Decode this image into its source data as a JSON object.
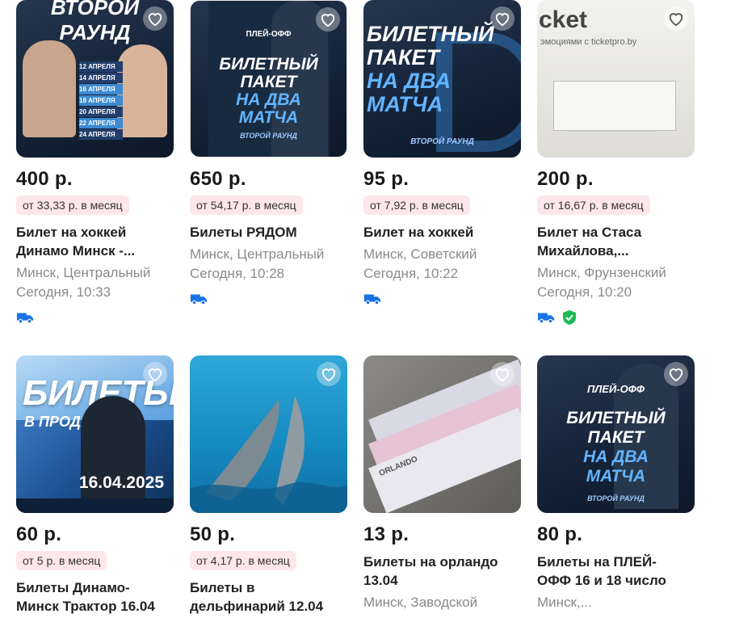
{
  "colors": {
    "credit_bg": "#fde7ea",
    "delivery": "#1a73e8",
    "verified": "#1db954"
  },
  "cards": [
    {
      "price": "400 р.",
      "credit": "от 33,33 р. в месяц",
      "title": [
        "Билет на хоккей",
        "Динамо Минск -..."
      ],
      "location": "Минск, Центральный",
      "time": "Сегодня, 10:33",
      "delivery": true,
      "verified": false,
      "image_text": [
        "ВТОРОЙ РАУНД",
        "12 АПРЕЛЯ",
        "14 АПРЕЛЯ",
        "16 АПРЕЛЯ",
        "18 АПРЕЛЯ",
        "20 АПРЕЛЯ",
        "22 АПРЕЛЯ",
        "24 АПРЕЛЯ"
      ]
    },
    {
      "price": "650 р.",
      "credit": "от 54,17 р. в месяц",
      "title": [
        "Билеты РЯДОМ"
      ],
      "location": "Минск, Центральный",
      "time": "Сегодня, 10:28",
      "delivery": true,
      "verified": false,
      "image_text": [
        "ПЛЕЙ-ОФФ",
        "БИЛЕТНЫЙ",
        "ПАКЕТ",
        "НА ДВА",
        "МАТЧА",
        "ВТОРОЙ РАУНД"
      ]
    },
    {
      "price": "95 р.",
      "credit": "от 7,92 р. в месяц",
      "title": [
        "Билет на хоккей"
      ],
      "location": "Минск, Советский",
      "time": "Сегодня, 10:22",
      "delivery": true,
      "verified": false,
      "image_text": [
        "БИЛЕТНЫЙ",
        "ПАКЕТ",
        "НА ДВА",
        "МАТЧА",
        "ВТОРОЙ РАУНД"
      ]
    },
    {
      "price": "200 р.",
      "credit": "от 16,67 р. в месяц",
      "title": [
        "Билет на Стаса",
        "Михайлова,..."
      ],
      "location": "Минск, Фрунзенский",
      "time": "Сегодня, 10:20",
      "delivery": true,
      "verified": true,
      "image_text": [
        "cket",
        "эмоциями с ticketpro.by"
      ]
    },
    {
      "price": "60 р.",
      "credit": "от 5 р. в месяц",
      "title": [
        "Билеты Динамо-",
        "Минск Трактор 16.04"
      ],
      "location": "",
      "time": "",
      "delivery": false,
      "verified": false,
      "image_text": [
        "БИЛЕТЫ",
        "В ПРОДАЖЕ",
        "16.04.2025"
      ]
    },
    {
      "price": "50 р.",
      "credit": "от 4,17 р. в месяц",
      "title": [
        "Билеты в",
        "дельфинарий 12.04"
      ],
      "location": "",
      "time": "",
      "delivery": false,
      "verified": false,
      "image_text": []
    },
    {
      "price": "13 р.",
      "credit": "",
      "title": [
        "Билеты на орландо",
        "13.04"
      ],
      "location": "Минск, Заводской",
      "time": "",
      "delivery": false,
      "verified": false,
      "image_text": [
        "ORLANDO"
      ]
    },
    {
      "price": "80 р.",
      "credit": "",
      "title": [
        "Билеты на ПЛЕЙ-",
        "ОФФ 16 и 18 число"
      ],
      "location": "Минск,...",
      "time": "",
      "delivery": false,
      "verified": false,
      "image_text": [
        "ПЛЕЙ-ОФФ",
        "БИЛЕТНЫЙ",
        "ПАКЕТ",
        "НА ДВА",
        "МАТЧА",
        "ВТОРОЙ РАУНД"
      ]
    }
  ]
}
